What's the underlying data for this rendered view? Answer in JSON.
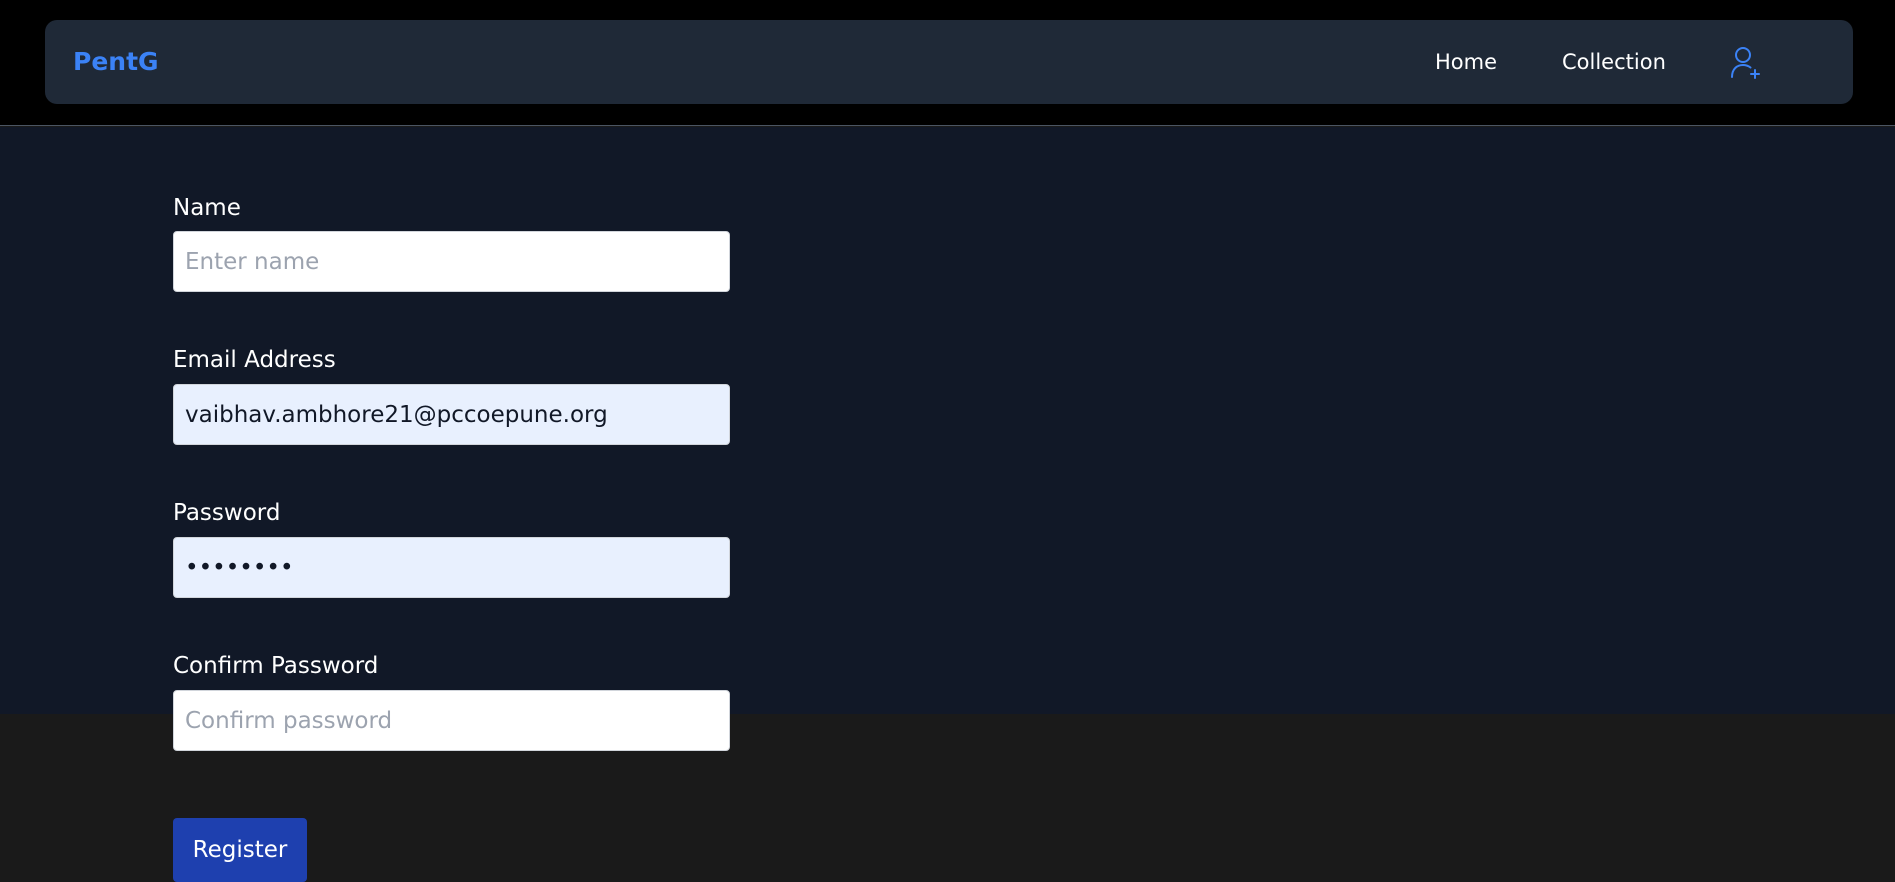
{
  "navbar": {
    "brand": "PentG",
    "links": [
      {
        "label": "Home"
      },
      {
        "label": "Collection"
      }
    ],
    "user_icon": "user-plus-icon"
  },
  "form": {
    "name": {
      "label": "Name",
      "value": "",
      "placeholder": "Enter name"
    },
    "email": {
      "label": "Email Address",
      "value": "vaibhav.ambhore21@pccoepune.org",
      "placeholder": ""
    },
    "password": {
      "label": "Password",
      "value": "••••••••",
      "placeholder": ""
    },
    "confirm_password": {
      "label": "Confirm Password",
      "value": "",
      "placeholder": "Confirm password"
    },
    "submit_label": "Register"
  },
  "colors": {
    "brand": "#3b82f6",
    "navbar_bg": "#1f2937",
    "page_bg": "#111827",
    "autofill_bg": "#e8f0fe",
    "button_bg": "#1e40af"
  }
}
